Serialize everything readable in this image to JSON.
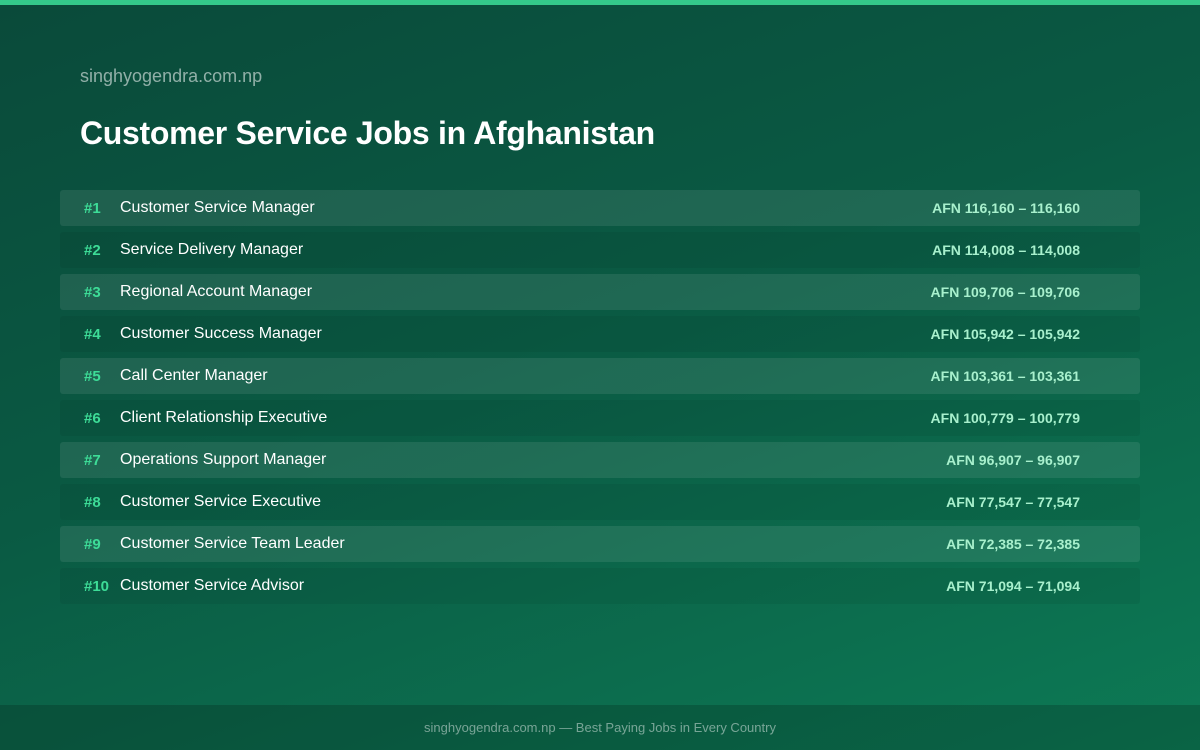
{
  "header": {
    "site_name": "singhyogendra.com.np",
    "title": "Customer Service Jobs in Afghanistan"
  },
  "colors": {
    "accent": "#34c98a",
    "rank": "#3ddc97",
    "salary": "#a8f0cd"
  },
  "jobs": [
    {
      "rank": "#1",
      "title": "Customer Service Manager",
      "salary": "AFN 116,160 – 116,160"
    },
    {
      "rank": "#2",
      "title": "Service Delivery Manager",
      "salary": "AFN 114,008 – 114,008"
    },
    {
      "rank": "#3",
      "title": "Regional Account Manager",
      "salary": "AFN 109,706 – 109,706"
    },
    {
      "rank": "#4",
      "title": "Customer Success Manager",
      "salary": "AFN 105,942 – 105,942"
    },
    {
      "rank": "#5",
      "title": "Call Center Manager",
      "salary": "AFN 103,361 – 103,361"
    },
    {
      "rank": "#6",
      "title": "Client Relationship Executive",
      "salary": "AFN 100,779 – 100,779"
    },
    {
      "rank": "#7",
      "title": "Operations Support Manager",
      "salary": "AFN 96,907 – 96,907"
    },
    {
      "rank": "#8",
      "title": "Customer Service Executive",
      "salary": "AFN 77,547 – 77,547"
    },
    {
      "rank": "#9",
      "title": "Customer Service Team Leader",
      "salary": "AFN 72,385 – 72,385"
    },
    {
      "rank": "#10",
      "title": "Customer Service Advisor",
      "salary": "AFN 71,094 – 71,094"
    }
  ],
  "footer": {
    "text": "singhyogendra.com.np — Best Paying Jobs in Every Country"
  }
}
